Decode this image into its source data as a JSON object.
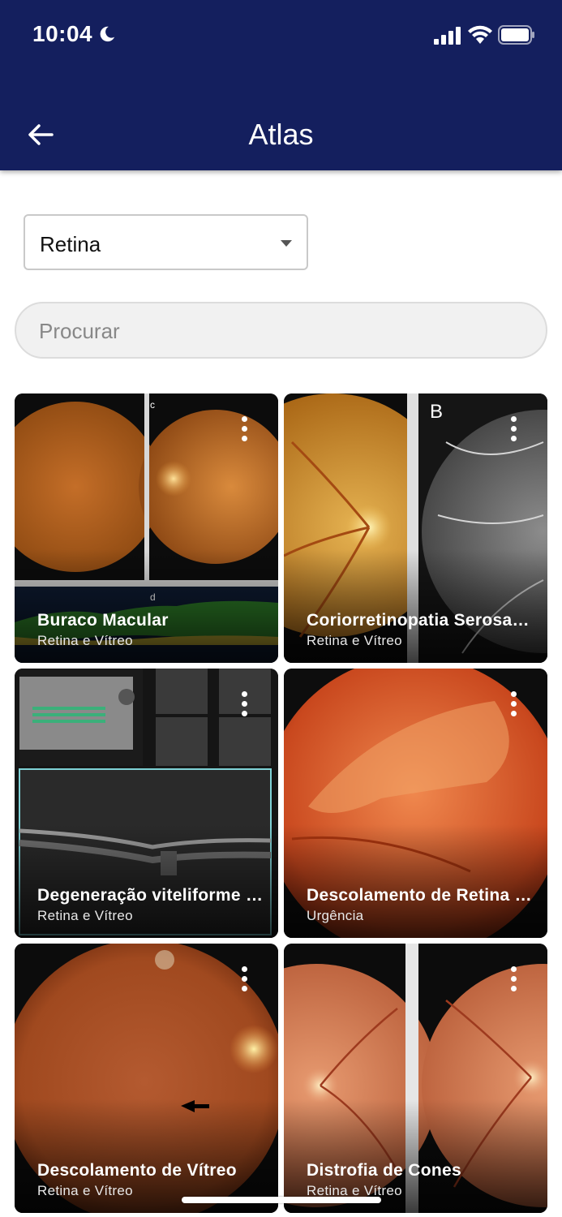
{
  "status_bar": {
    "time": "10:04",
    "icons": [
      "moon-icon",
      "cellular-signal-icon",
      "wifi-icon",
      "battery-icon"
    ]
  },
  "app_bar": {
    "title": "Atlas",
    "back_icon": "arrow-left-icon",
    "background_color": "#141f5e"
  },
  "filter": {
    "selected": "Retina"
  },
  "search": {
    "placeholder": "Procurar",
    "value": ""
  },
  "cards": [
    {
      "title": "Buraco Macular",
      "subtitle": "Retina e Vítreo"
    },
    {
      "title": "Coriorretinopatia Serosa Central",
      "subtitle": "Retina e Vítreo"
    },
    {
      "title": "Degeneração viteliforme do adulto",
      "subtitle": "Retina e Vítreo"
    },
    {
      "title": "Descolamento de Retina Regmatogênico",
      "subtitle": "Urgência"
    },
    {
      "title": "Descolamento de Vítreo",
      "subtitle": "Retina e Vítreo"
    },
    {
      "title": "Distrofia de Cones",
      "subtitle": "Retina e Vítreo"
    }
  ]
}
